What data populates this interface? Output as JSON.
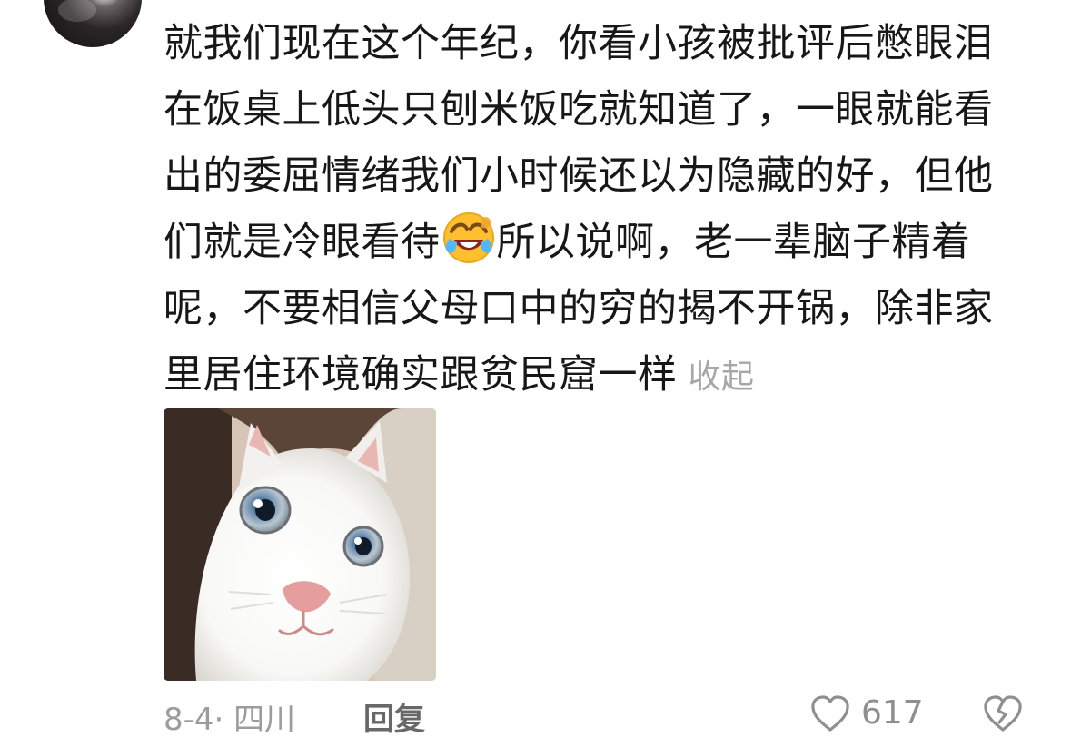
{
  "comment": {
    "lines": [
      "就我们现在这个年纪，你看小孩被批评后憋眼泪",
      "在饭桌上低头只刨米饭吃就知道了，一眼就能看",
      "出的委屈情绪我们小时候还以为隐藏的好，但他",
      "们就是冷眼看待",
      "所以说啊，老一辈脑子精着",
      "呢，不要相信父母口中的穷的揭不开锅，除非家",
      "里居住环境确实跟贫民窟一样"
    ],
    "collapse_label": "收起",
    "emoji_icon": "laughing-crying-emoji"
  },
  "image": {
    "subject": "white-cat-face"
  },
  "footer": {
    "date_location": "8-4· 四川",
    "reply_label": "回复",
    "like_count": "617",
    "like_icon": "heart-outline-icon",
    "dislike_icon": "broken-heart-icon"
  },
  "colors": {
    "text": "#171717",
    "muted": "#a7a7a7",
    "footer": "#9c9c9c"
  }
}
